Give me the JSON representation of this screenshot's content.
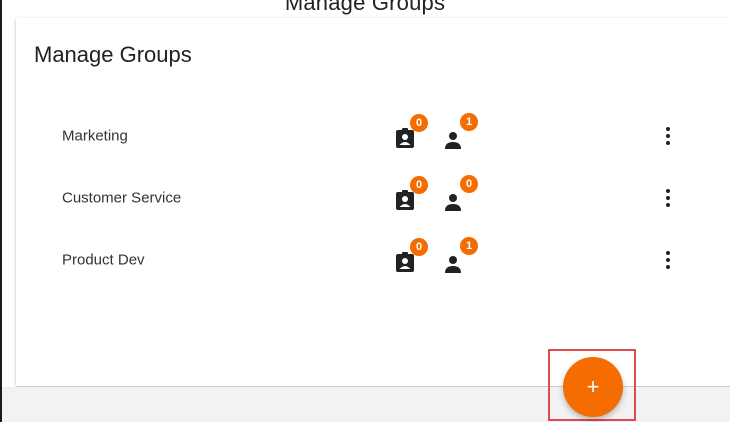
{
  "page": {
    "heading_cut": "Manage Groups"
  },
  "card": {
    "title": "Manage Groups"
  },
  "groups": [
    {
      "name": "Marketing",
      "badges": {
        "clipboard": "0",
        "person": "1"
      }
    },
    {
      "name": "Customer Service",
      "badges": {
        "clipboard": "0",
        "person": "0"
      }
    },
    {
      "name": "Product Dev",
      "badges": {
        "clipboard": "0",
        "person": "1"
      }
    }
  ],
  "icons": {
    "clipboard": "clipboard-account-icon",
    "person": "person-icon",
    "more": "more-vert-icon",
    "add": "plus-icon"
  },
  "fab": {
    "label": "+"
  },
  "colors": {
    "accent": "#f56c00",
    "highlight_border": "#e04a4a",
    "text_primary": "#212121"
  }
}
